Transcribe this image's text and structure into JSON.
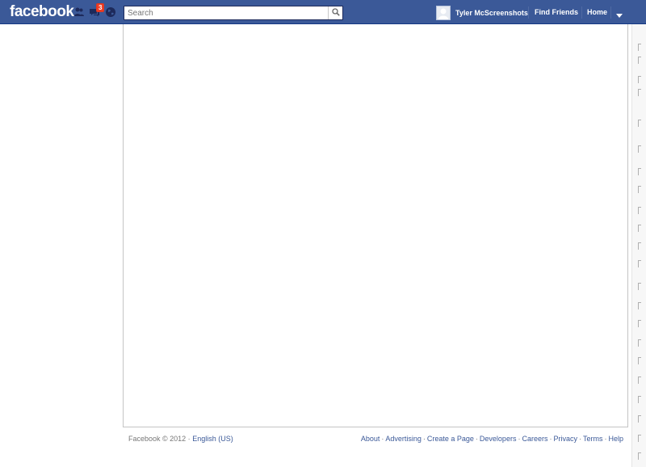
{
  "header": {
    "logo": "facebook",
    "notification_count": "3",
    "search_placeholder": "Search",
    "profile_name": "Tyler McScreenshots",
    "find_friends": "Find Friends",
    "home": "Home"
  },
  "footer": {
    "copyright": "Facebook © 2012 ·",
    "language": "English (US)",
    "links": [
      "About",
      "Advertising",
      "Create a Page",
      "Developers",
      "Careers",
      "Privacy",
      "Terms",
      "Help"
    ]
  },
  "colors": {
    "brand_blue": "#3b5998",
    "badge_red": "#f03d25"
  },
  "icons": [
    "friend-requests-icon",
    "messages-icon",
    "notifications-globe-icon",
    "search-icon",
    "dropdown-arrow-icon"
  ]
}
